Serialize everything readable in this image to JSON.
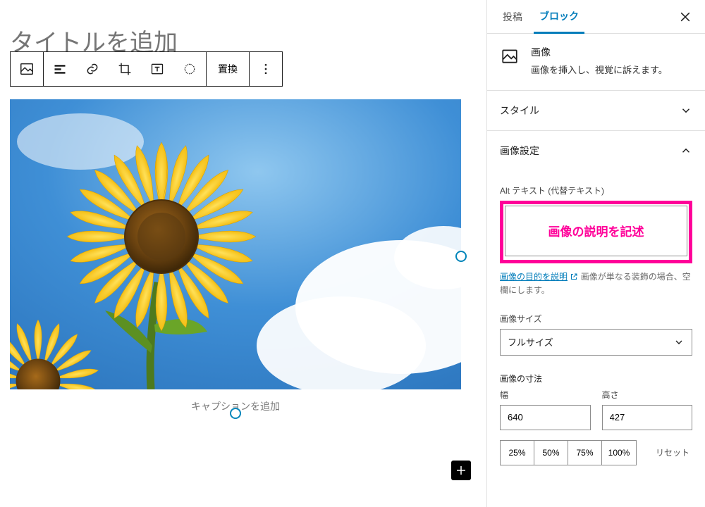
{
  "editor": {
    "title_placeholder": "タイトルを追加",
    "toolbar": {
      "replace_label": "置換"
    },
    "caption_placeholder": "キャプションを追加"
  },
  "sidebar": {
    "tabs": {
      "post": "投稿",
      "block": "ブロック"
    },
    "block_card": {
      "name": "画像",
      "description": "画像を挿入し、視覚に訴えます。"
    },
    "panels": {
      "style_title": "スタイル",
      "image_settings_title": "画像設定"
    },
    "alt": {
      "label": "Alt テキスト (代替テキスト)",
      "value": "画像の説明を記述",
      "help_link": "画像の目的を説明",
      "help_rest": "画像が単なる装飾の場合、空欄にします。"
    },
    "size": {
      "label": "画像サイズ",
      "selected": "フルサイズ"
    },
    "dimensions": {
      "title": "画像の寸法",
      "width_label": "幅",
      "height_label": "高さ",
      "width": "640",
      "height": "427",
      "presets": [
        "25%",
        "50%",
        "75%",
        "100%"
      ],
      "reset": "リセット"
    }
  }
}
